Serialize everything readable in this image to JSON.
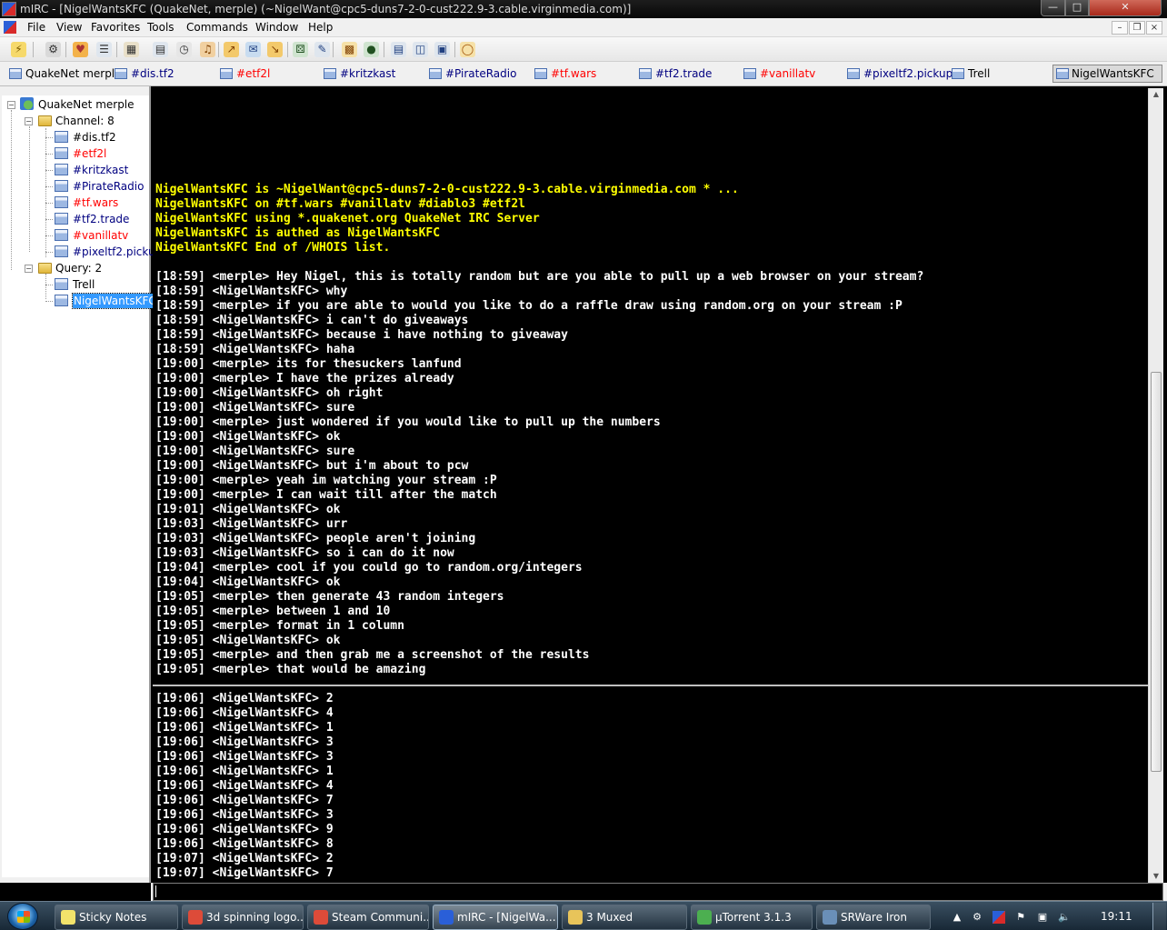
{
  "window": {
    "title": "mIRC - [NigelWantsKFC (QuakeNet, merple) (~NigelWant@cpc5-duns7-2-0-cust222.9-3.cable.virginmedia.com)]"
  },
  "menu": [
    "File",
    "View",
    "Favorites",
    "Tools",
    "Commands",
    "Window",
    "Help"
  ],
  "switchbar": [
    {
      "label": "QuakeNet merple",
      "color": "#000000"
    },
    {
      "label": "#dis.tf2",
      "color": "#000080"
    },
    {
      "label": "#etf2l",
      "color": "#ff0000"
    },
    {
      "label": "#kritzkast",
      "color": "#000080"
    },
    {
      "label": "#PirateRadio",
      "color": "#000080"
    },
    {
      "label": "#tf.wars",
      "color": "#ff0000"
    },
    {
      "label": "#tf2.trade",
      "color": "#000080"
    },
    {
      "label": "#vanillatv",
      "color": "#ff0000"
    },
    {
      "label": "#pixeltf2.pickup",
      "color": "#000080"
    },
    {
      "label": "Trell",
      "color": "#000000"
    },
    {
      "label": "NigelWantsKFC",
      "color": "#000000"
    }
  ],
  "tree": {
    "network": "QuakeNet merple",
    "channels_folder": "Channel: 8",
    "channels": [
      {
        "label": "#dis.tf2",
        "color": "#000000"
      },
      {
        "label": "#etf2l",
        "color": "#ff0000"
      },
      {
        "label": "#kritzkast",
        "color": "#000080"
      },
      {
        "label": "#PirateRadio",
        "color": "#000080"
      },
      {
        "label": "#tf.wars",
        "color": "#ff0000"
      },
      {
        "label": "#tf2.trade",
        "color": "#000080"
      },
      {
        "label": "#vanillatv",
        "color": "#ff0000"
      },
      {
        "label": "#pixeltf2.pickup",
        "color": "#000080"
      }
    ],
    "query_folder": "Query: 2",
    "queries": [
      {
        "label": "Trell",
        "selected": false
      },
      {
        "label": "NigelWantsKFC",
        "selected": true
      }
    ]
  },
  "whois": [
    "NigelWantsKFC is ~NigelWant@cpc5-duns7-2-0-cust222.9-3.cable.virginmedia.com * ...",
    "NigelWantsKFC on #tf.wars #vanillatv #diablo3 #etf2l",
    "NigelWantsKFC using *.quakenet.org QuakeNet IRC Server",
    "NigelWantsKFC is authed as NigelWantsKFC",
    "NigelWantsKFC End of /WHOIS list."
  ],
  "chat_lines": [
    "[18:59] <merple> Hey Nigel, this is totally random but are you able to pull up a web browser on your stream?",
    "[18:59] <NigelWantsKFC> why",
    "[18:59] <merple> if you are able to would you like to do a raffle draw using random.org on your stream :P",
    "[18:59] <NigelWantsKFC> i can't do giveaways",
    "[18:59] <NigelWantsKFC> because i have nothing to giveaway",
    "[18:59] <NigelWantsKFC> haha",
    "[19:00] <merple> its for thesuckers lanfund",
    "[19:00] <merple> I have the prizes already",
    "[19:00] <NigelWantsKFC> oh right",
    "[19:00] <NigelWantsKFC> sure",
    "[19:00] <merple> just wondered if you would like to pull up the numbers",
    "[19:00] <NigelWantsKFC> ok",
    "[19:00] <NigelWantsKFC> sure",
    "[19:00] <NigelWantsKFC> but i'm about to pcw",
    "[19:00] <merple> yeah im watching your stream :P",
    "[19:00] <merple> I can wait till after the match",
    "[19:01] <NigelWantsKFC> ok",
    "[19:03] <NigelWantsKFC> urr",
    "[19:03] <NigelWantsKFC> people aren't joining",
    "[19:03] <NigelWantsKFC> so i can do it now",
    "[19:04] <merple> cool if you could go to random.org/integers",
    "[19:04] <NigelWantsKFC> ok",
    "[19:05] <merple> then generate 43 random integers",
    "[19:05] <merple> between 1 and 10",
    "[19:05] <merple> format in 1 column",
    "[19:05] <NigelWantsKFC> ok",
    "[19:05] <merple> and then grab me a screenshot of the results",
    "[19:05] <merple> that would be amazing"
  ],
  "lower_lines": [
    "[19:06] <NigelWantsKFC> 2",
    "[19:06] <NigelWantsKFC> 4",
    "[19:06] <NigelWantsKFC> 1",
    "[19:06] <NigelWantsKFC> 3",
    "[19:06] <NigelWantsKFC> 3",
    "[19:06] <NigelWantsKFC> 1",
    "[19:06] <NigelWantsKFC> 4",
    "[19:06] <NigelWantsKFC> 7",
    "[19:06] <NigelWantsKFC> 3",
    "[19:06] <NigelWantsKFC> 9",
    "[19:06] <NigelWantsKFC> 8",
    "[19:07] <NigelWantsKFC> 2",
    "[19:07] <NigelWantsKFC> 7"
  ],
  "input": {
    "value": ""
  },
  "taskbar": {
    "items": [
      {
        "label": "Sticky Notes",
        "icon_color": "#f2e36b",
        "active": false
      },
      {
        "label": "3d spinning logo...",
        "icon_color": "#dd4b39",
        "active": false
      },
      {
        "label": "Steam Communi...",
        "icon_color": "#dd4b39",
        "active": false
      },
      {
        "label": "mIRC - [NigelWa...",
        "icon_color": "#2a5fd8",
        "active": true
      },
      {
        "label": "3 Muxed",
        "icon_color": "#e8c45a",
        "active": false
      },
      {
        "label": "µTorrent 3.1.3",
        "icon_color": "#4caf50",
        "active": false
      },
      {
        "label": "SRWare Iron",
        "icon_color": "#6a8fb8",
        "active": false
      }
    ],
    "clock": "19:11"
  },
  "colors": {
    "chat_bg": "#000000",
    "chat_text": "#ffffff",
    "whois_text": "#ffff00"
  }
}
